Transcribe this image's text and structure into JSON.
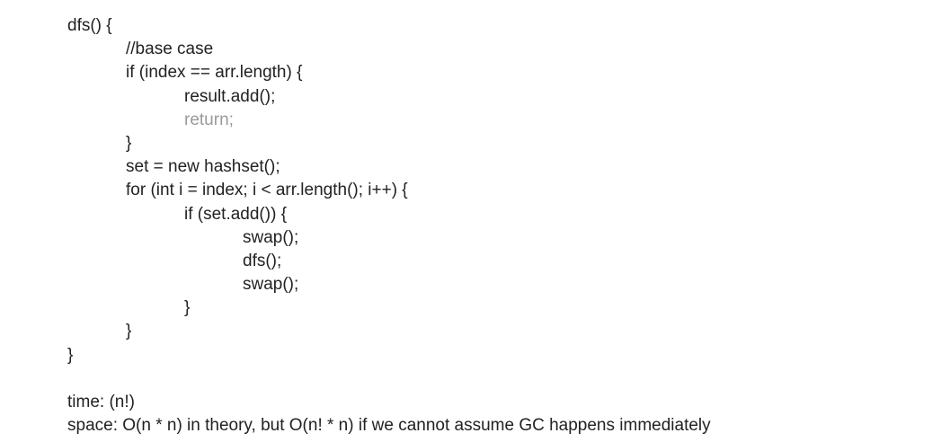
{
  "code": {
    "lines": [
      "dfs() {",
      "//base case",
      "if (index == arr.length) {",
      "result.add();",
      "return;",
      "}",
      "set = new hashset();",
      "for (int i = index; i < arr.length(); i++) {",
      "if (set.add()) {",
      "swap();",
      "dfs();",
      "swap();",
      "}",
      "}",
      "}"
    ]
  },
  "notes": {
    "time": "time: (n!)",
    "space": "space: O(n * n) in theory, but O(n! * n) if we cannot assume GC happens immediately"
  }
}
